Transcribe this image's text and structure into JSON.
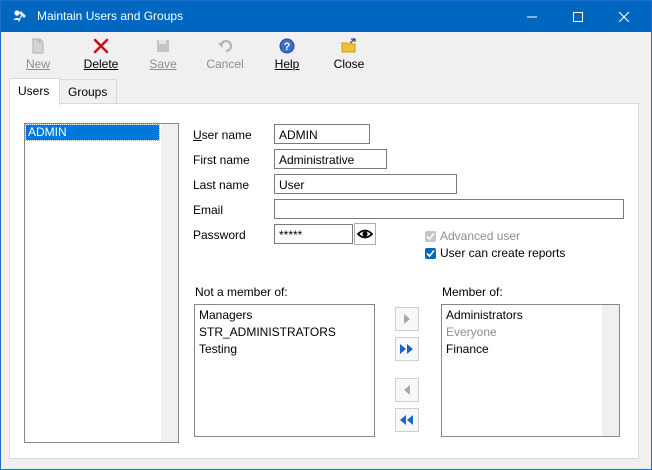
{
  "window": {
    "title": "Maintain Users and Groups",
    "accent_color": "#0067c0"
  },
  "toolbar": {
    "buttons": [
      {
        "label": "New",
        "icon": "new-document-icon",
        "enabled": false
      },
      {
        "label": "Delete",
        "icon": "delete-x-icon",
        "enabled": true
      },
      {
        "label": "Save",
        "icon": "save-disk-icon",
        "enabled": false
      },
      {
        "label": "Cancel",
        "icon": "undo-icon",
        "enabled": false
      },
      {
        "label": "Help",
        "icon": "help-question-icon",
        "enabled": true
      },
      {
        "label": "Close",
        "icon": "close-folder-icon",
        "enabled": true
      }
    ]
  },
  "tabs": [
    {
      "label": "Users",
      "active": true
    },
    {
      "label": "Groups",
      "active": false
    }
  ],
  "users": {
    "items": [
      "ADMIN"
    ],
    "selected": "ADMIN"
  },
  "form": {
    "user_name": {
      "label": "User name",
      "value": "ADMIN"
    },
    "first_name": {
      "label": "First name",
      "value": "Administrative"
    },
    "last_name": {
      "label": "Last name",
      "value": "User"
    },
    "email": {
      "label": "Email",
      "value": ""
    },
    "password": {
      "label": "Password",
      "value": "*****"
    },
    "advanced_user": {
      "label": "Advanced user",
      "checked": true,
      "enabled": false
    },
    "create_reports": {
      "label": "User can create reports",
      "checked": true,
      "enabled": true
    }
  },
  "groups": {
    "not_member_label": "Not a member of:",
    "member_label": "Member of:",
    "not_member": [
      "Managers",
      "STR_ADMINISTRATORS",
      "Testing"
    ],
    "member": [
      {
        "name": "Administrators",
        "enabled": true
      },
      {
        "name": "Everyone",
        "enabled": false
      },
      {
        "name": "Finance",
        "enabled": true
      }
    ]
  }
}
